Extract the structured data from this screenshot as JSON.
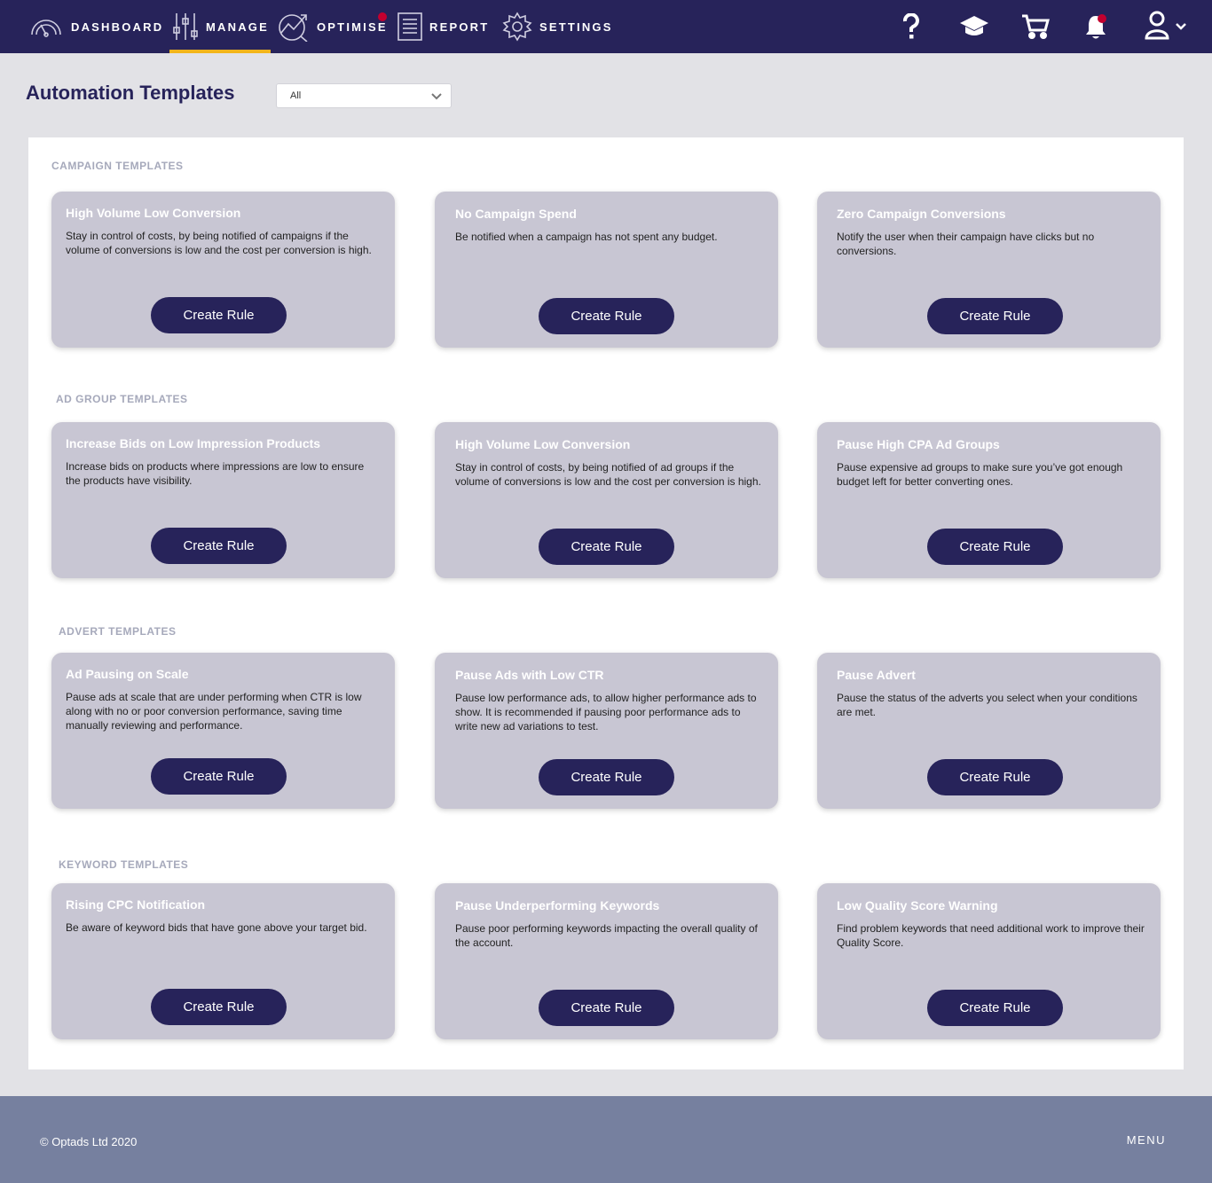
{
  "nav": {
    "items": [
      {
        "label": "DASHBOARD",
        "icon": "gauge-icon",
        "active": false
      },
      {
        "label": "MANAGE",
        "icon": "sliders-icon",
        "active": true
      },
      {
        "label": "OPTIMISE",
        "icon": "trend-chart-icon",
        "active": false,
        "notification": true
      },
      {
        "label": "REPORT",
        "icon": "document-icon",
        "active": false
      },
      {
        "label": "SETTINGS",
        "icon": "gear-icon",
        "active": false
      }
    ],
    "right_icons": [
      "help-icon",
      "graduation-cap-icon",
      "cart-icon",
      "bell-icon",
      "user-icon"
    ],
    "accent_color": "#f2b51b",
    "notification_color": "#c3002f",
    "background_color": "#27235a"
  },
  "page": {
    "title": "Automation Templates",
    "filter": {
      "selected": "All"
    }
  },
  "sections": [
    {
      "title": "CAMPAIGN TEMPLATES",
      "cards": [
        {
          "title": "High Volume Low Conversion",
          "description": "Stay in control of costs, by being notified of campaigns if the volume of conversions is low and the cost per conversion is high.",
          "button": "Create Rule"
        },
        {
          "title": "No Campaign Spend",
          "description": "Be notified when a campaign has not spent any budget.",
          "button": "Create Rule"
        },
        {
          "title": "Zero Campaign Conversions",
          "description": "Notify the user when their campaign have clicks but no conversions.",
          "button": "Create Rule"
        }
      ]
    },
    {
      "title": "AD GROUP TEMPLATES",
      "cards": [
        {
          "title": "Increase Bids on Low Impression Products",
          "description": "Increase bids on products where impressions are low to ensure the products have visibility.",
          "button": "Create Rule"
        },
        {
          "title": "High Volume Low Conversion",
          "description": "Stay in control of costs, by being notified of ad groups if the volume of conversions is low and the cost per conversion is high.",
          "button": "Create Rule"
        },
        {
          "title": "Pause High CPA Ad Groups",
          "description": "Pause expensive ad groups to make sure you’ve got enough budget left for better converting ones.",
          "button": "Create Rule"
        }
      ]
    },
    {
      "title": "ADVERT TEMPLATES",
      "cards": [
        {
          "title": "Ad Pausing on Scale",
          "description": "Pause ads at scale that are under performing when CTR is low along with no or poor conversion performance, saving time manually reviewing and performance.",
          "button": "Create Rule"
        },
        {
          "title": "Pause Ads with Low CTR",
          "description": "Pause low performance ads, to allow higher performance ads to show. It is recommended if pausing poor performance ads to write new ad variations to test.",
          "button": "Create Rule"
        },
        {
          "title": "Pause Advert",
          "description": "Pause the status of the adverts you select when your conditions are met.",
          "button": "Create Rule"
        }
      ]
    },
    {
      "title": "KEYWORD TEMPLATES",
      "cards": [
        {
          "title": "Rising CPC Notification",
          "description": "Be aware of keyword bids that have gone above your target bid.",
          "button": "Create Rule"
        },
        {
          "title": "Pause Underperforming Keywords",
          "description": "Pause poor performing keywords impacting the overall quality of the account.",
          "button": "Create Rule"
        },
        {
          "title": "Low Quality Score Warning",
          "description": "Find problem keywords that need additional work to improve their Quality Score.",
          "button": "Create Rule"
        }
      ]
    }
  ],
  "footer": {
    "copyright": "© Optads Ltd 2020",
    "menu_label": "MENU"
  }
}
